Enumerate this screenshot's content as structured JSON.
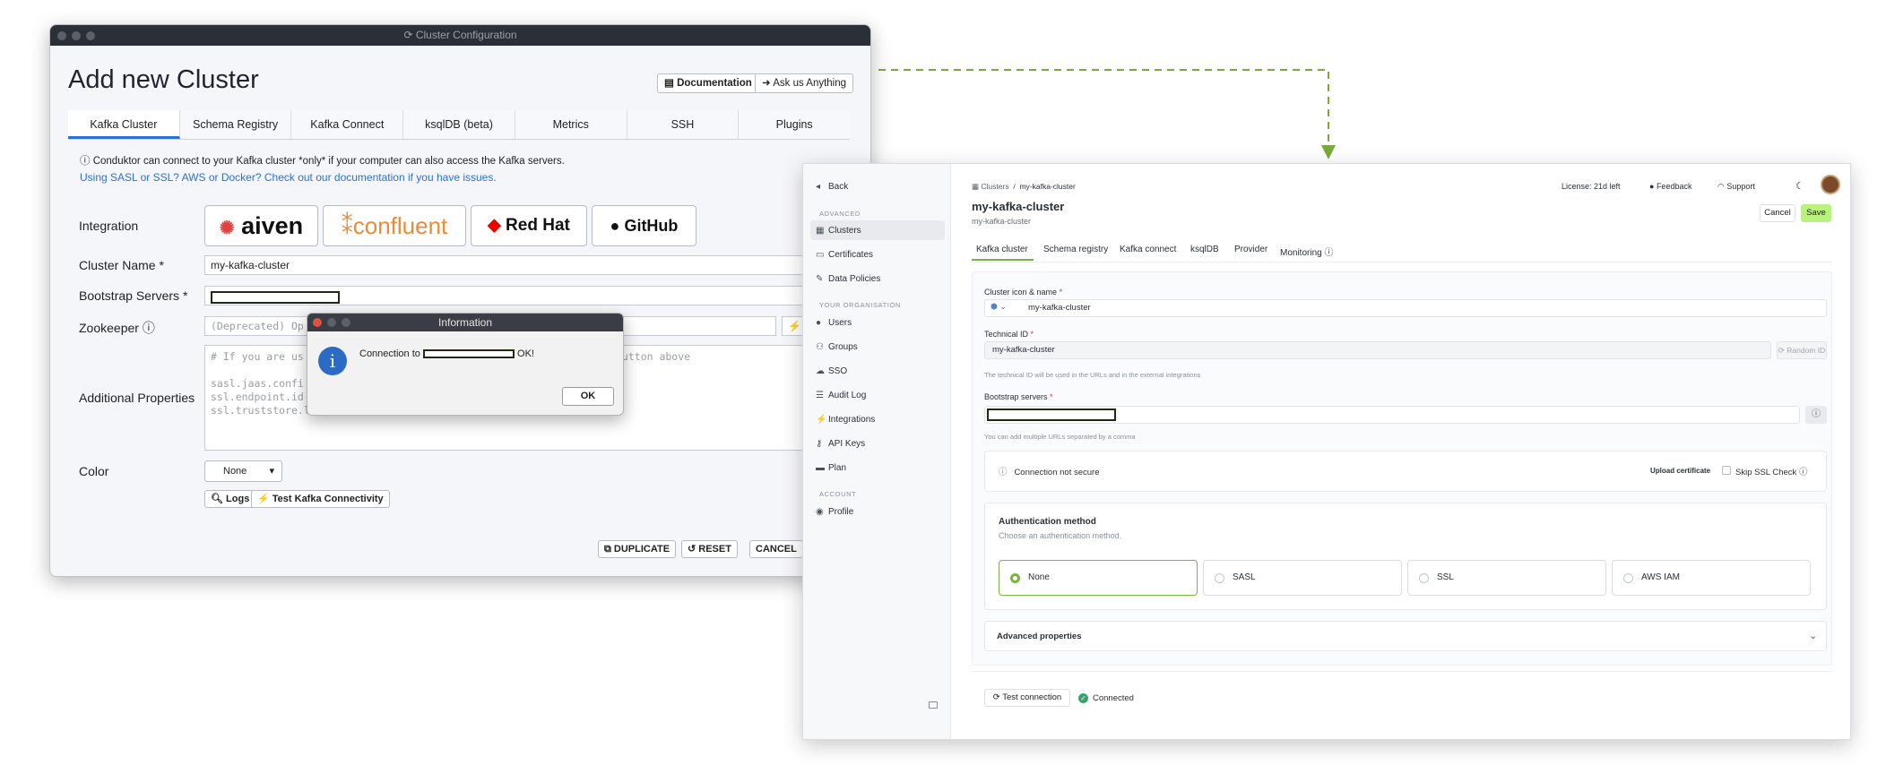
{
  "desktop": {
    "window_title": "Cluster Configuration",
    "heading": "Add new Cluster",
    "documentation_button": "Documentation",
    "ask_button": "Ask us Anything",
    "tabs": [
      "Kafka Cluster",
      "Schema Registry",
      "Kafka Connect",
      "ksqlDB (beta)",
      "Metrics",
      "SSH",
      "Plugins"
    ],
    "info_text": "Conduktor can connect to your Kafka cluster *only* if your computer can also access the Kafka servers.",
    "help_link": "Using SASL or SSL? AWS or Docker? Check out our documentation if you have issues.",
    "integration_label": "Integration",
    "logos": [
      "aiven",
      "confluent",
      "Red Hat",
      "GitHub"
    ],
    "cluster_name_label": "Cluster Name *",
    "cluster_name_value": "my-kafka-cluster",
    "bootstrap_label": "Bootstrap Servers *",
    "zookeeper_label": "Zookeeper",
    "zookeeper_placeholder": "(Deprecated) Op",
    "additional_label": "Additional Properties",
    "props_lines": [
      "# If you are us",
      "sasl.jaas.confi",
      "ssl.endpoint.id",
      "ssl.truststore.location=..."
    ],
    "props_hint": "button above",
    "color_label": "Color",
    "color_value": "None",
    "logs_button": "Logs",
    "test_button": "Test Kafka Connectivity",
    "duplicate_button": "DUPLICATE",
    "reset_button": "RESET",
    "cancel_button": "CANCEL",
    "dialog": {
      "title": "Information",
      "message_prefix": "Connection to",
      "message_suffix": "OK!",
      "ok_button": "OK"
    }
  },
  "web": {
    "back": "Back",
    "sections": [
      "ADVANCED",
      "YOUR ORGANISATION",
      "ACCOUNT"
    ],
    "advanced_items": [
      "Clusters",
      "Certificates",
      "Data Policies"
    ],
    "org_items": [
      "Users",
      "Groups",
      "SSO",
      "Audit Log",
      "Integrations",
      "API Keys",
      "Plan"
    ],
    "account_items": [
      "Profile"
    ],
    "breadcrumb_root": "Clusters",
    "breadcrumb_sep": "/",
    "breadcrumb_current": "my-kafka-cluster",
    "license": "License: 21d left",
    "feedback": "Feedback",
    "support": "Support",
    "title": "my-kafka-cluster",
    "subtitle": "my-kafka-cluster",
    "cancel": "Cancel",
    "save": "Save",
    "tabs": [
      "Kafka cluster",
      "Schema registry",
      "Kafka connect",
      "ksqlDB",
      "Provider",
      "Monitoring"
    ],
    "icon_name_label": "Cluster icon & name",
    "icon_name_value": "my-kafka-cluster",
    "technical_id_label": "Technical ID",
    "technical_id_value": "my-kafka-cluster",
    "random_id": "Random ID",
    "technical_hint": "The technical ID will be used in the URLs and in the external integrations",
    "bootstrap_label": "Bootstrap servers",
    "bootstrap_hint": "You can add multiple URLs separated by a comma",
    "connection_status": "Connection not secure",
    "upload_cert": "Upload certificate",
    "skip_ssl": "Skip SSL Check",
    "auth_title": "Authentication method",
    "auth_hint": "Choose an authentication method.",
    "auth_options": [
      "None",
      "SASL",
      "SSL",
      "AWS IAM"
    ],
    "advanced_props": "Advanced properties",
    "test_connection": "Test connection",
    "connected": "Connected",
    "required_mark": "*",
    "colors": {
      "accent": "#7bb241",
      "link": "#2f6fd6",
      "save_bg": "#b9f27c"
    }
  }
}
